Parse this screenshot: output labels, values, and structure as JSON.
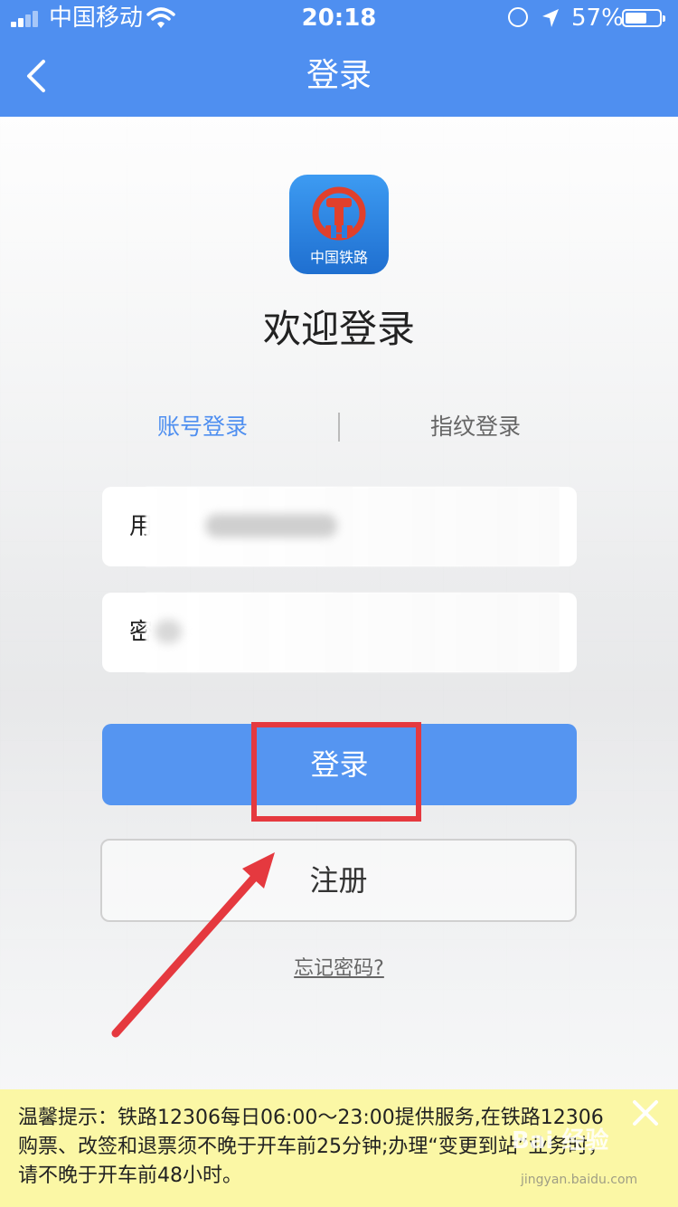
{
  "status_bar": {
    "carrier": "中国移动",
    "time": "20:18",
    "battery_percent": "57%",
    "battery_level": 0.57
  },
  "nav": {
    "title": "登录",
    "back_icon": "chevron-left-icon"
  },
  "logo": {
    "text": "中国铁路",
    "accent": "#e0402c"
  },
  "welcome": "欢迎登录",
  "tabs": [
    {
      "label": "账号登录",
      "active": true
    },
    {
      "label": "指纹登录",
      "active": false
    }
  ],
  "form": {
    "username_label": "用",
    "password_label": "密"
  },
  "buttons": {
    "login": "登录",
    "register": "注册",
    "forgot": "忘记密码?"
  },
  "notice": {
    "text": "温馨提示：铁路12306每日06:00～23:00提供服务,在铁路12306购票、改签和退票须不晚于开车前25分钟;办理“变更到站”业务时，请不晚于开车前48小时。"
  },
  "watermark": {
    "text": "Bai 经验",
    "sub": "jingyan.baidu.com"
  },
  "colors": {
    "primary": "#4f8ff0",
    "highlight": "#e5393f",
    "notice_bg": "#fbf7a5"
  }
}
